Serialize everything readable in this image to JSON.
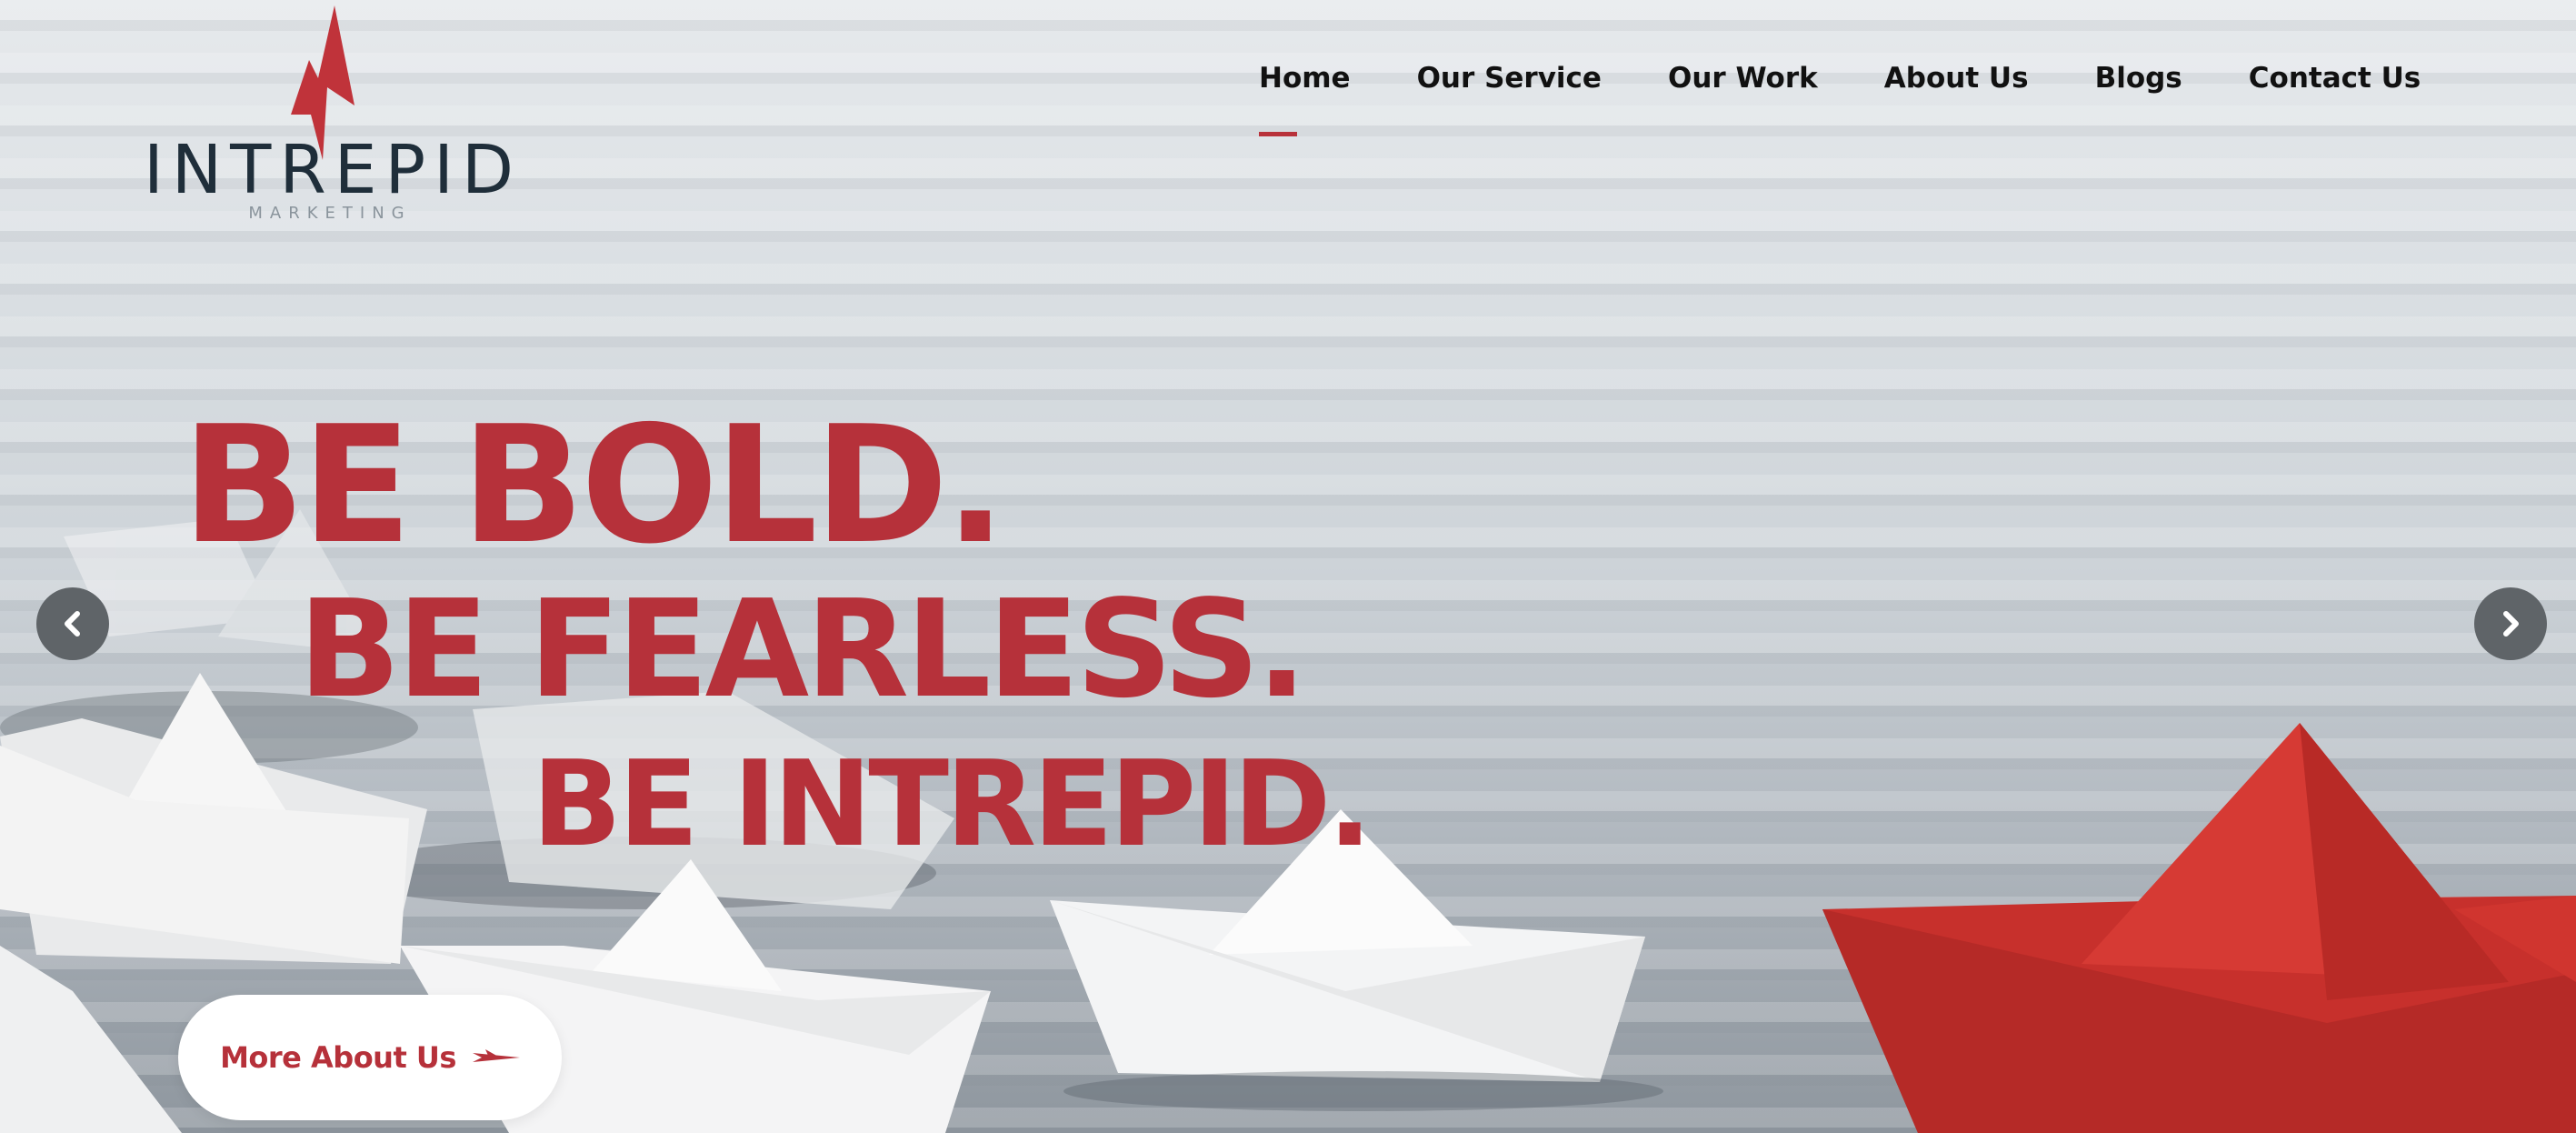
{
  "logo": {
    "name": "INTREPID",
    "tagline": "MARKETING"
  },
  "nav": {
    "items": [
      {
        "label": "Home",
        "active": true
      },
      {
        "label": "Our Service",
        "active": false
      },
      {
        "label": "Our Work",
        "active": false
      },
      {
        "label": "About Us",
        "active": false
      },
      {
        "label": "Blogs",
        "active": false
      },
      {
        "label": "Contact Us",
        "active": false
      }
    ]
  },
  "hero": {
    "line1": "BE BOLD.",
    "line2": "BE FEARLESS.",
    "line3": "BE INTREPID.",
    "cta_label": "More About Us"
  },
  "slider": {
    "prev_icon": "chevron-left-icon",
    "next_icon": "chevron-right-icon"
  },
  "colors": {
    "accent": "#b6313a",
    "nav_text": "#111111",
    "logo_text": "#1f2e3a"
  }
}
